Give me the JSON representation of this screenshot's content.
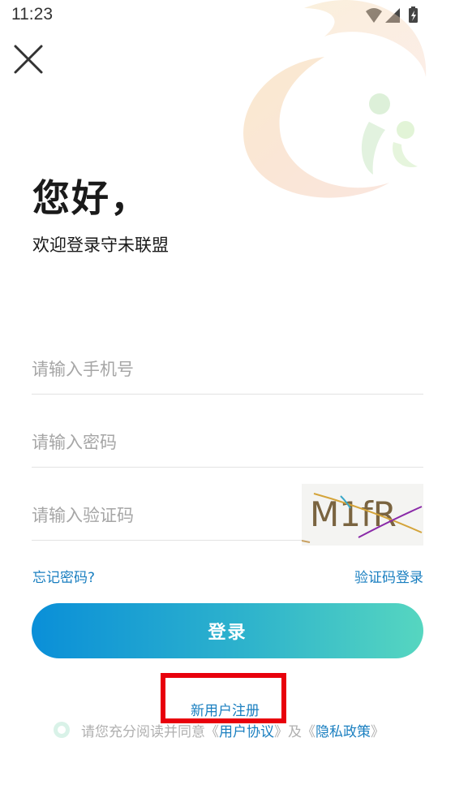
{
  "status_bar": {
    "time": "11:23",
    "icons": [
      "wifi-icon",
      "signal-icon",
      "battery-charging-icon"
    ]
  },
  "header": {
    "close_icon": "close-icon"
  },
  "greeting": {
    "title": "您好，",
    "subtitle": "欢迎登录守未联盟"
  },
  "form": {
    "phone_placeholder": "请输入手机号",
    "password_placeholder": "请输入密码",
    "captcha_placeholder": "请输入验证码",
    "captcha_text": "M1fR"
  },
  "links": {
    "forgot_password": "忘记密码?",
    "code_login": "验证码登录"
  },
  "login_button": "登录",
  "register_link": "新用户注册",
  "agreement": {
    "prefix": "请您充分阅读并同意",
    "open_quote": "《",
    "user_agreement": "用户协议",
    "close_quote": "》",
    "and": "及",
    "privacy_policy": "隐私政策"
  },
  "colors": {
    "accent": "#1a7fc0",
    "button_gradient_start": "#0a8fd8",
    "button_gradient_end": "#56d6c0",
    "highlight": "#e8000c"
  }
}
